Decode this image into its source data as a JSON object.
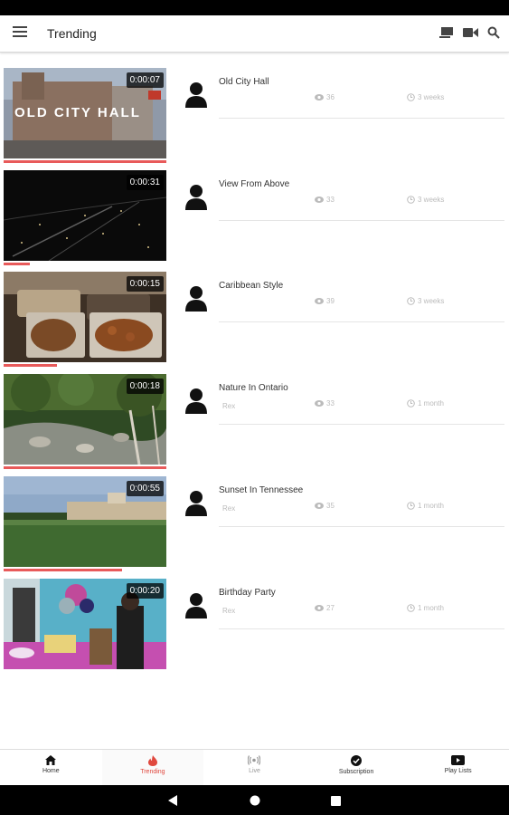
{
  "header": {
    "title": "Trending"
  },
  "videos": [
    {
      "title": "Old City Hall",
      "duration": "0:00:07",
      "channel": "",
      "views": "36",
      "age": "3 weeks",
      "progress": 1.0
    },
    {
      "title": "View From Above",
      "duration": "0:00:31",
      "channel": "",
      "views": "33",
      "age": "3 weeks",
      "progress": 0.16
    },
    {
      "title": "Caribbean Style",
      "duration": "0:00:15",
      "channel": "",
      "views": "39",
      "age": "3 weeks",
      "progress": 0.33
    },
    {
      "title": "Nature In Ontario",
      "duration": "0:00:18",
      "channel": "Rex",
      "views": "33",
      "age": "1 month",
      "progress": 1.0
    },
    {
      "title": "Sunset In Tennessee",
      "duration": "0:00:55",
      "channel": "Rex",
      "views": "35",
      "age": "1 month",
      "progress": 0.73
    },
    {
      "title": "Birthday Party",
      "duration": "0:00:20",
      "channel": "Rex",
      "views": "27",
      "age": "1 month",
      "progress": 0.0
    }
  ],
  "thumbnail_text": {
    "old_city_hall": "OLD CITY HALL"
  },
  "bottom_nav": [
    {
      "label": "Home",
      "icon": "home-icon"
    },
    {
      "label": "Trending",
      "icon": "flame-icon"
    },
    {
      "label": "Live",
      "icon": "live-icon"
    },
    {
      "label": "Subscription",
      "icon": "check-circle-icon"
    },
    {
      "label": "Play Lists",
      "icon": "play-box-icon"
    }
  ],
  "colors": {
    "accent": "#e0483e",
    "progress": "#e85a5a"
  }
}
